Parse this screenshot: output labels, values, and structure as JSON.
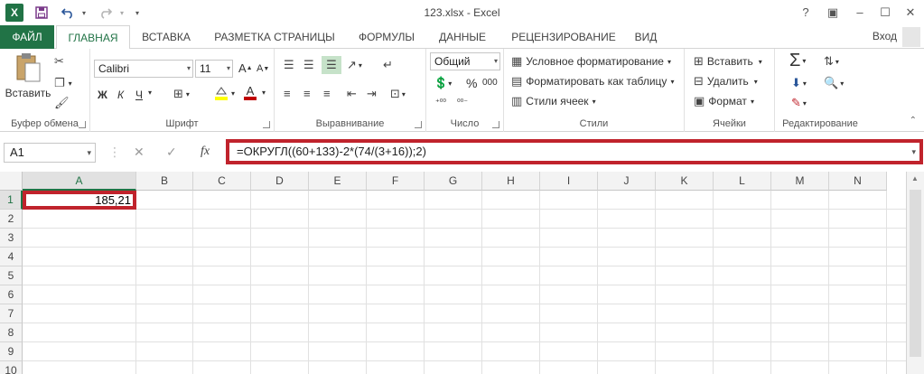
{
  "title": "123.xlsx - Excel",
  "quick_access": {
    "logo": "X",
    "save_icon": "floppy-icon",
    "undo_icon": "undo-icon",
    "redo_icon": "redo-icon",
    "customize_icon": "chevron-down-icon"
  },
  "window_controls": {
    "help": "?",
    "ribbon_display": "▣",
    "minimize": "–",
    "maximize": "☐",
    "close": "✕"
  },
  "tabs": [
    "ФАЙЛ",
    "ГЛАВНАЯ",
    "ВСТАВКА",
    "РАЗМЕТКА СТРАНИЦЫ",
    "ФОРМУЛЫ",
    "ДАННЫЕ",
    "РЕЦЕНЗИРОВАНИЕ",
    "ВИД"
  ],
  "active_tab": "ГЛАВНАЯ",
  "signin": "Вход",
  "ribbon": {
    "clipboard": {
      "label": "Буфер обмена",
      "paste": "Вставить"
    },
    "font": {
      "label": "Шрифт",
      "name": "Calibri",
      "size": "11",
      "bold": "Ж",
      "italic": "К",
      "underline": "Ч",
      "grow": "A",
      "shrink": "A",
      "font_color": "А"
    },
    "alignment": {
      "label": "Выравнивание"
    },
    "number": {
      "label": "Число",
      "format": "Общий",
      "percent": "%",
      "thousands": "000"
    },
    "styles": {
      "label": "Стили",
      "conditional": "Условное форматирование",
      "as_table": "Форматировать как таблицу",
      "cell_styles": "Стили ячеек"
    },
    "cells": {
      "label": "Ячейки",
      "insert": "Вставить",
      "delete": "Удалить",
      "format": "Формат"
    },
    "editing": {
      "label": "Редактирование"
    }
  },
  "formula_bar": {
    "name_box": "A1",
    "cancel": "✕",
    "enter": "✓",
    "fx": "fx",
    "formula": "=ОКРУГЛ((60+133)-2*(74/(3+16));2)"
  },
  "grid": {
    "columns": [
      "A",
      "B",
      "C",
      "D",
      "E",
      "F",
      "G",
      "H",
      "I",
      "J",
      "K",
      "L",
      "M",
      "N"
    ],
    "rows": [
      "1",
      "2",
      "3",
      "4",
      "5",
      "6",
      "7",
      "8",
      "9",
      "10"
    ],
    "active_cell": "A1",
    "a1_value": "185,21"
  },
  "colors": {
    "accent": "#217346",
    "highlight": "#c0232c"
  }
}
